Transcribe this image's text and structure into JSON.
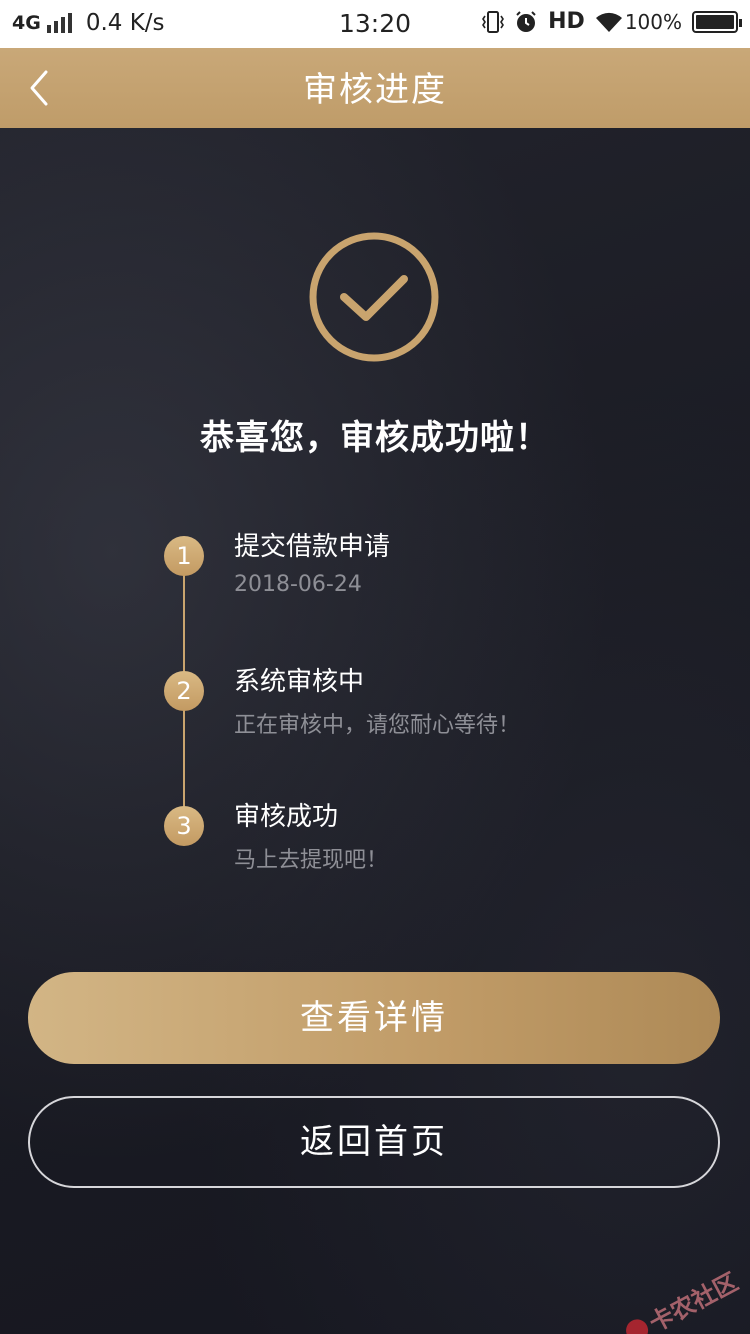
{
  "status_bar": {
    "network": "4G",
    "speed": "0.4 K/s",
    "time": "13:20",
    "hd": "HD",
    "battery": "100%"
  },
  "nav": {
    "title": "审核进度"
  },
  "result": {
    "title": "恭喜您，审核成功啦！"
  },
  "steps": [
    {
      "number": "1",
      "title": "提交借款申请",
      "subtitle": "2018-06-24"
    },
    {
      "number": "2",
      "title": "系统审核中",
      "subtitle": "正在审核中，请您耐心等待！"
    },
    {
      "number": "3",
      "title": "审核成功",
      "subtitle": "马上去提现吧！"
    }
  ],
  "buttons": {
    "detail": "查看详情",
    "home": "返回首页"
  },
  "watermark": {
    "text": "卡农社区"
  },
  "colors": {
    "accent_gold": "#c9a46e",
    "background": "#1b1c24"
  }
}
